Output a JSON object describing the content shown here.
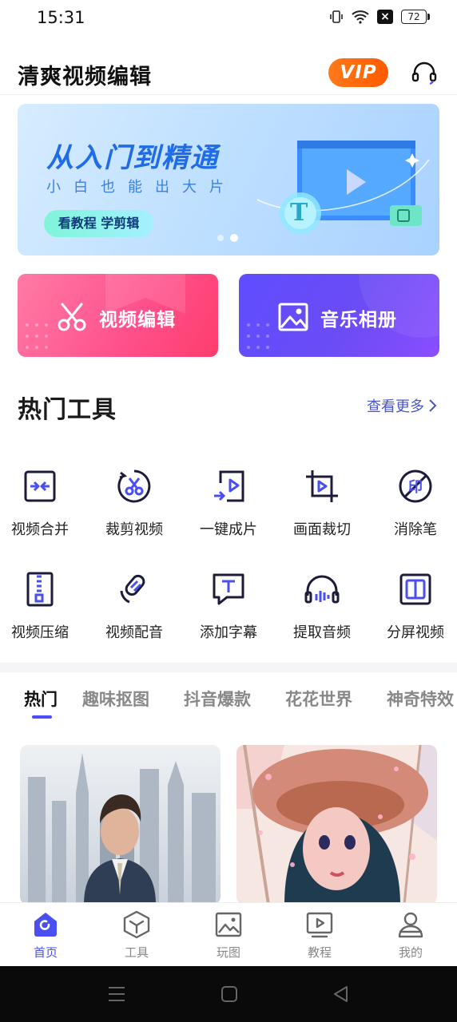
{
  "status": {
    "time": "15:31",
    "battery": "72"
  },
  "header": {
    "title": "清爽视频编辑",
    "vip": "VIP"
  },
  "banner": {
    "title": "从入门到精通",
    "subtitle": "小白也能出大片",
    "button": "看教程 学剪辑",
    "icon_letter": "T"
  },
  "big_buttons": {
    "video_edit": "视频编辑",
    "music_album": "音乐相册"
  },
  "hot_tools": {
    "title": "热门工具",
    "more": "查看更多",
    "items": [
      {
        "label": "视频合并",
        "icon": "merge-icon"
      },
      {
        "label": "裁剪视频",
        "icon": "cut-icon"
      },
      {
        "label": "一键成片",
        "icon": "oneclick-icon"
      },
      {
        "label": "画面裁切",
        "icon": "crop-icon"
      },
      {
        "label": "消除笔",
        "icon": "eraser-icon"
      },
      {
        "label": "视频压缩",
        "icon": "compress-icon"
      },
      {
        "label": "视频配音",
        "icon": "dubbing-icon"
      },
      {
        "label": "添加字幕",
        "icon": "subtitle-icon"
      },
      {
        "label": "提取音频",
        "icon": "audio-extract-icon"
      },
      {
        "label": "分屏视频",
        "icon": "split-screen-icon"
      }
    ]
  },
  "categories": [
    "热门",
    "趣味抠图",
    "抖音爆款",
    "花花世界",
    "神奇特效"
  ],
  "bottom_nav": [
    {
      "label": "首页",
      "icon": "home-icon"
    },
    {
      "label": "工具",
      "icon": "tools-icon"
    },
    {
      "label": "玩图",
      "icon": "image-icon"
    },
    {
      "label": "教程",
      "icon": "tutorial-icon"
    },
    {
      "label": "我的",
      "icon": "profile-icon"
    }
  ],
  "colors": {
    "accent": "#4a4ff2",
    "vip": "#ff6a00",
    "pink": "#ff4f8a",
    "purple": "#6b4cf5"
  }
}
